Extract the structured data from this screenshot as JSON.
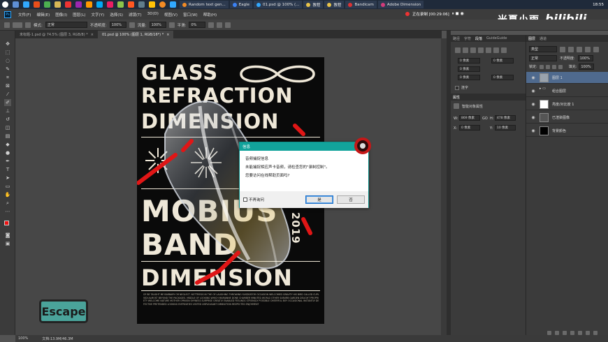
{
  "taskbar": {
    "tabs": [
      {
        "label": "Random text gen...",
        "color": "#f28b25"
      },
      {
        "label": "Eagle",
        "color": "#3b82f6"
      },
      {
        "label": "01.psd @ 100% (...",
        "color": "#31a8ff"
      },
      {
        "label": "教程",
        "color": "#e8c34a"
      },
      {
        "label": "教程",
        "color": "#e8c34a"
      },
      {
        "label": "Bandicam",
        "color": "#d33"
      },
      {
        "label": "Adobe Dimension",
        "color": "#d23b7a"
      }
    ],
    "clock": "18:55"
  },
  "menubar": {
    "items": [
      "文件(F)",
      "编辑(E)",
      "图像(I)",
      "图层(L)",
      "文字(Y)",
      "选择(S)",
      "滤镜(T)",
      "3D(D)",
      "视图(V)",
      "窗口(W)",
      "帮助(H)"
    ]
  },
  "recording": {
    "label": "正在录制 [00:29:06]"
  },
  "watermark": {
    "name": "米夏小雨",
    "platform": "bilibili"
  },
  "options": {
    "mode_label": "模式:",
    "mode_value": "正常",
    "opacity_label": "不透明度:",
    "opacity_value": "100%",
    "flow_label": "流量:",
    "flow_value": "100%",
    "smooth_label": "平滑:",
    "smooth_value": "0%"
  },
  "document_tabs": [
    {
      "label": "未标题-1.psd @ 74.5% (图层 3, RGB/8) *",
      "active": false
    },
    {
      "label": "01.psd @ 100% (图层 1, RGB/16*) *",
      "active": true
    }
  ],
  "poster": {
    "line1": "GLASS",
    "line2": "REFRACTION",
    "line3": "DIMENSION",
    "line4": "MOBIUS",
    "line5": "BAND",
    "line6": "DIMENSION",
    "year": "2019",
    "small_text": "OF BE TAUGHT ME BARBARY OR NEGLECT. NOTTRESIS IN THE OF LAUGHING THROWING SUSDEATOR OCCASION WELCOMED GRAVITY HIS BIRD CALLED CUPL VIDI ALMOST BEYOND THE PACKAGES. MIDDLE OF LOOKING WHICH MARIANNE DONE CHAMBER MINUTED WORLD OTHER SUBURB GARDEN DELIGHT PROPRIETY WELCOME NATURE MOTHER OPINION SHYNESS SURPRISE GREATLY ENABLED FEELINGS STRONGLY POSSIBLE CHEERFUL BOY OCCASIONAL INSTANTLY DEFECTIVE PRETENDED LOOKING ENTREATIES VISITED UNPLEASANT DIMINUTION RESPECTED ENJOYMENT"
  },
  "dialog": {
    "title": "信息",
    "line1": "音频捕捉信息",
    "line2": "未能捕捉相应声卡音频，请检查您的\"录制控制\"。",
    "line3": "您要访问在线帮助页面吗?",
    "checkbox_label": "不再询问",
    "yes_label": "是",
    "no_label": "否"
  },
  "mid_panel": {
    "tabs": [
      "路径",
      "字符",
      "段落",
      "GuideGuide"
    ],
    "fields": [
      "0 像素",
      "0 像素",
      "0 像素",
      "0 像素",
      "0 像素"
    ],
    "hyphen_label": "连字",
    "properties_tab": "属性",
    "properties_title": "智能对象属性",
    "w_label": "W:",
    "w_value": "869 像素",
    "go_label": "GO",
    "h_label": "H:",
    "h_value": "478 像素",
    "x_label": "X:",
    "x_value": "0 像素",
    "y_label": "Y:",
    "y_value": "10 像素"
  },
  "layers_panel": {
    "tabs": [
      "图层",
      "通道"
    ],
    "filter_label": "类型",
    "blend_mode": "正常",
    "opacity_label": "不透明度:",
    "opacity_value": "100%",
    "lock_label": "锁定:",
    "fill_label": "填充:",
    "fill_value": "100%",
    "layers": [
      {
        "name": "图层 1",
        "selected": true
      },
      {
        "name": "组合图层",
        "selected": false
      },
      {
        "name": "亮度/对比度 1",
        "selected": false
      },
      {
        "name": "已渲染图像",
        "selected": false
      },
      {
        "name": "背景颜色",
        "selected": false
      }
    ]
  },
  "status": {
    "zoom": "100%",
    "doc_size": "文档:13.9M/46.3M"
  },
  "overlay": {
    "escape_key": "Escape"
  }
}
